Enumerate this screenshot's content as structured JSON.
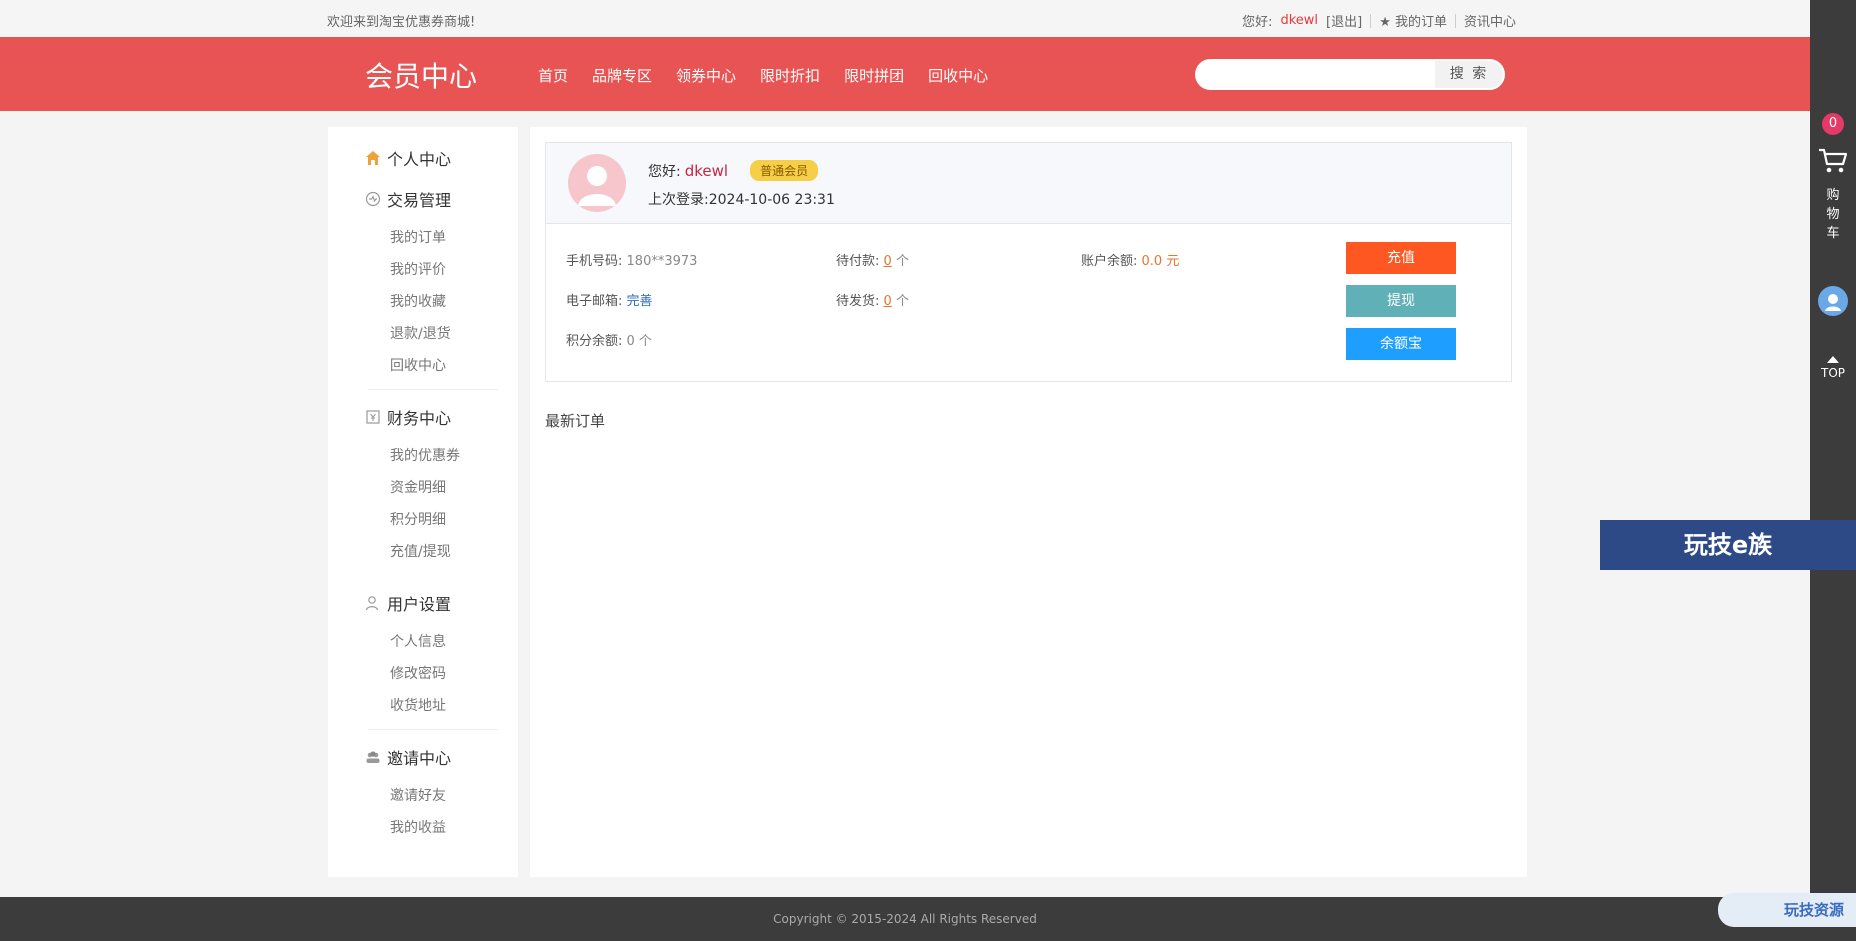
{
  "topbar": {
    "welcome": "欢迎来到淘宝优惠券商城!",
    "hello_prefix": "您好:",
    "username": "dkewl",
    "logout": "[退出]",
    "my_orders": "★ 我的订单",
    "news": "资讯中心"
  },
  "header": {
    "title": "会员中心",
    "nav": [
      "首页",
      "品牌专区",
      "领券中心",
      "限时折扣",
      "限时拼团",
      "回收中心"
    ],
    "search_button": "搜 索",
    "search_placeholder": ""
  },
  "sidebar": {
    "personal": "个人中心",
    "groups": [
      {
        "title": "交易管理",
        "icon": "trade-icon",
        "items": [
          "我的订单",
          "我的评价",
          "我的收藏",
          "退款/退货",
          "回收中心"
        ]
      },
      {
        "title": "财务中心",
        "icon": "finance-icon",
        "items": [
          "我的优惠券",
          "资金明细",
          "积分明细",
          "充值/提现"
        ]
      },
      {
        "title": "用户设置",
        "icon": "user-icon",
        "items": [
          "个人信息",
          "修改密码",
          "收货地址"
        ]
      },
      {
        "title": "邀请中心",
        "icon": "invite-icon",
        "items": [
          "邀请好友",
          "我的收益"
        ]
      }
    ]
  },
  "profile": {
    "hello_label": "您好:",
    "name": "dkewl",
    "level": "普通会员",
    "last_login_label": "上次登录:",
    "last_login": "2024-10-06 23:31",
    "phone_label": "手机号码:",
    "phone": "180**3973",
    "email_label": "电子邮箱:",
    "email_action": "完善",
    "points_label": "积分余额:",
    "points": "0 个",
    "pending_pay_label": "待付款:",
    "pending_pay": "0",
    "pending_ship_label": "待发货:",
    "pending_ship": "0",
    "unit_ge": "个",
    "balance_label": "账户余额:",
    "balance": "0.0 元",
    "btn_recharge": "充值",
    "btn_withdraw": "提现",
    "btn_yuebao": "余额宝"
  },
  "main": {
    "latest_orders": "最新订单"
  },
  "rightbar": {
    "cart_count": "0",
    "cart_text": "购物车",
    "top": "TOP"
  },
  "footer": {
    "copyright": "Copyright © 2015-2024 All Rights Reserved"
  },
  "watermarks": {
    "top": "玩技e族",
    "bottom": "玩技资源"
  },
  "colors": {
    "header": "#e85353",
    "recharge": "#ff5722",
    "withdraw": "#5fb0b7",
    "yuebao": "#1e9fff"
  }
}
